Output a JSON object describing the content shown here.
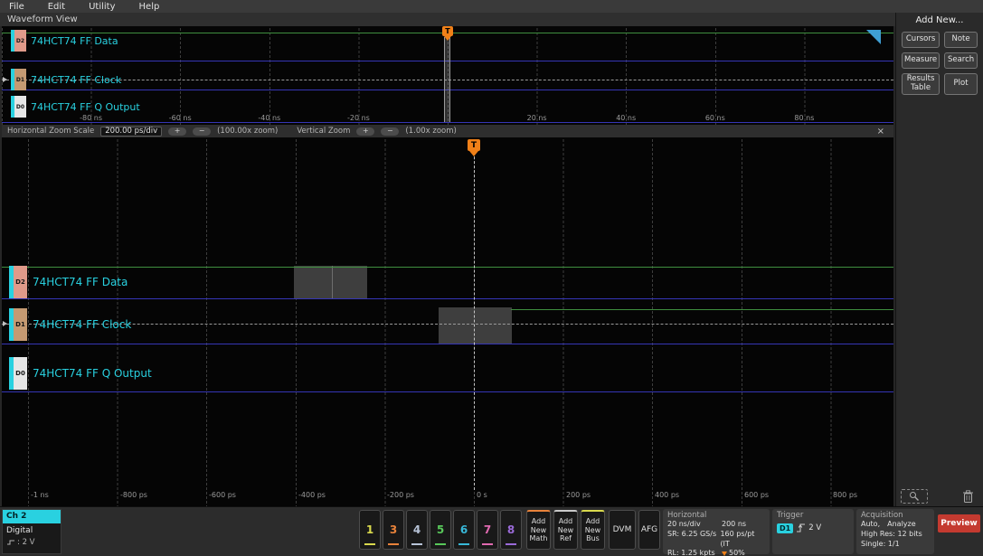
{
  "colors": {
    "accent_cyan": "#29d1e0",
    "trace_green": "#3f8f3f",
    "trace_blue": "#3535b5",
    "trigger_orange": "#f08018",
    "preview_red": "#c43a30",
    "chip_d2": "#e09a8a",
    "chip_d1": "#c59a72",
    "chip_d0": "#e6e6e6"
  },
  "menu": {
    "items": [
      "File",
      "Edit",
      "Utility",
      "Help"
    ]
  },
  "view_header": {
    "title": "Waveform View"
  },
  "trigger": {
    "label": "T"
  },
  "channels": [
    {
      "id": "D2",
      "label": "74HCT74 FF Data"
    },
    {
      "id": "D1",
      "label": "74HCT74 FF Clock"
    },
    {
      "id": "D0",
      "label": "74HCT74 FF Q Output"
    }
  ],
  "overview": {
    "ticks": [
      "-80 ns",
      "-60 ns",
      "-40 ns",
      "-20 ns",
      "20 ns",
      "40 ns",
      "60 ns",
      "80 ns"
    ]
  },
  "zoom_bar": {
    "h_scale_label": "Horizontal Zoom Scale",
    "h_scale_value": "200.00 ps/div",
    "h_zoom_readout": "(100.00x zoom)",
    "v_zoom_label": "Vertical Zoom",
    "v_zoom_readout": "(1.00x zoom)",
    "plus": "+",
    "minus": "−",
    "close": "×"
  },
  "main_view": {
    "ticks": [
      "-1 ns",
      "-800 ps",
      "-600 ps",
      "-400 ps",
      "-200 ps",
      "0 s",
      "200 ps",
      "400 ps",
      "600 ps",
      "800 ps"
    ]
  },
  "right_panel": {
    "title": "Add New...",
    "buttons": [
      "Cursors",
      "Note",
      "Measure",
      "Search",
      "Results Table",
      "Plot"
    ]
  },
  "badge": {
    "name": "Ch 2",
    "type": "Digital",
    "threshold": ": 2 V"
  },
  "channel_buttons": [
    {
      "n": "1",
      "color": "#d9d94d"
    },
    {
      "n": "3",
      "color": "#e8823a"
    },
    {
      "n": "4",
      "color": "#b8c4d8"
    },
    {
      "n": "5",
      "color": "#58c85a"
    },
    {
      "n": "6",
      "color": "#38b8d8"
    },
    {
      "n": "7",
      "color": "#e06ab0"
    },
    {
      "n": "8",
      "color": "#9a6ad8"
    }
  ],
  "add_buttons": [
    {
      "label": "Add New Math"
    },
    {
      "label": "Add New Ref"
    },
    {
      "label": "Add New Bus"
    }
  ],
  "instrument_buttons": {
    "dvm": "DVM",
    "afg": "AFG"
  },
  "horizontal_panel": {
    "title": "Horizontal",
    "scale": "20 ns/div",
    "duration": "200 ns",
    "sample_rate": "SR: 6.25 GS/s",
    "resolution": "160 ps/pt (IT",
    "record_length": "RL: 1.25 kpts",
    "position": "50%"
  },
  "trigger_panel": {
    "title": "Trigger",
    "source": "D1",
    "level": "2 V"
  },
  "acquisition_panel": {
    "title": "Acquisition",
    "mode": "Auto,",
    "analyze": "Analyze",
    "row2": "High Res: 12 bits",
    "row3": "Single: 1/1"
  },
  "preview_button": {
    "label": "Preview"
  }
}
